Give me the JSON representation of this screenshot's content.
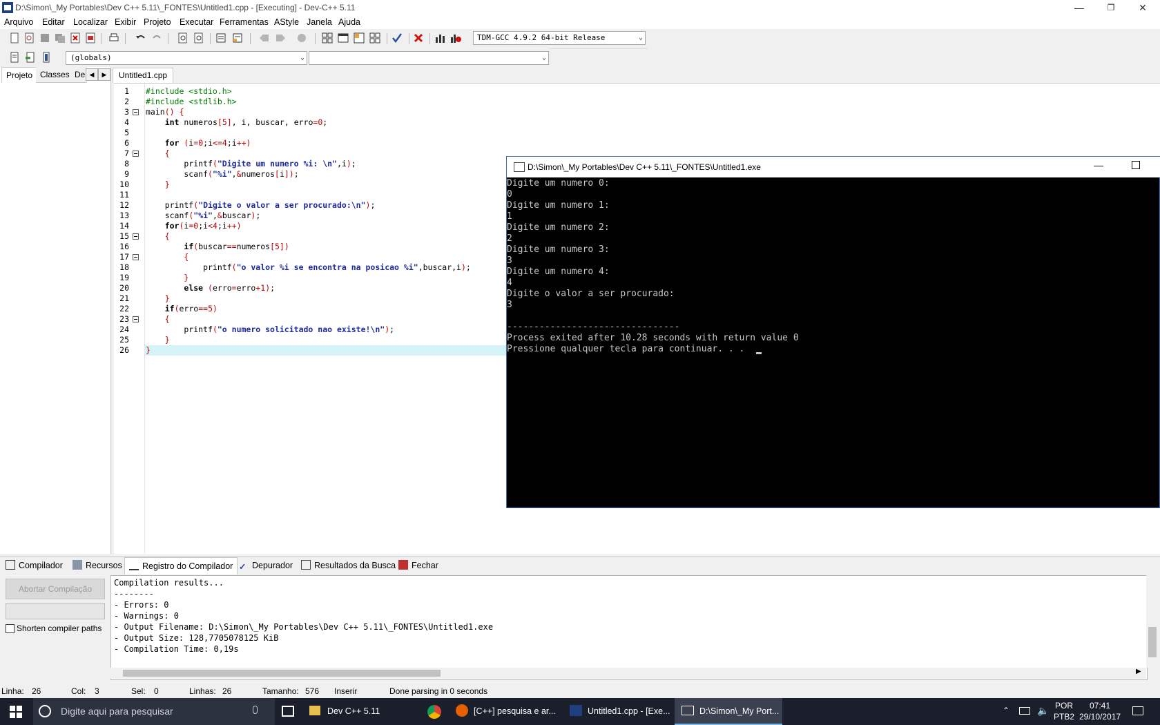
{
  "window": {
    "title": "D:\\Simon\\_My Portables\\Dev C++ 5.11\\_FONTES\\Untitled1.cpp - [Executing] - Dev-C++ 5.11"
  },
  "menu": [
    "Arquivo",
    "Editar",
    "Localizar",
    "Exibir",
    "Projeto",
    "Executar",
    "Ferramentas",
    "AStyle",
    "Janela",
    "Ajuda"
  ],
  "toolbar": {
    "compiler": "TDM-GCC 4.9.2 64-bit Release"
  },
  "toolbar2": {
    "scope": "(globals)",
    "member": ""
  },
  "leftpane": {
    "tabs": [
      "Projeto",
      "Classes",
      "De"
    ]
  },
  "editor": {
    "tab": "Untitled1.cpp",
    "line_numbers": [
      "1",
      "2",
      "3",
      "4",
      "5",
      "6",
      "7",
      "8",
      "9",
      "10",
      "11",
      "12",
      "13",
      "14",
      "15",
      "16",
      "17",
      "18",
      "19",
      "20",
      "21",
      "22",
      "23",
      "24",
      "25",
      "26"
    ]
  },
  "console": {
    "title": "D:\\Simon\\_My Portables\\Dev C++ 5.11\\_FONTES\\Untitled1.exe",
    "output": "Digite um numero 0:\n0\nDigite um numero 1:\n1\nDigite um numero 2:\n2\nDigite um numero 3:\n3\nDigite um numero 4:\n4\nDigite o valor a ser procurado:\n3\n\n--------------------------------\nProcess exited after 10.28 seconds with return value 0\nPressione qualquer tecla para continuar. . . "
  },
  "bottom": {
    "tabs": [
      "Compilador",
      "Recursos",
      "Registro do Compilador",
      "Depurador",
      "Resultados da Busca",
      "Fechar"
    ],
    "abort_label": "Abortar Compilação",
    "shorten_label": "Shorten compiler paths",
    "log": "Compilation results...\n--------\n- Errors: 0\n- Warnings: 0\n- Output Filename: D:\\Simon\\_My Portables\\Dev C++ 5.11\\_FONTES\\Untitled1.exe\n- Output Size: 128,7705078125 KiB\n- Compilation Time: 0,19s"
  },
  "status": {
    "linha_label": "Linha:",
    "linha": "26",
    "col_label": "Col:",
    "col": "3",
    "sel_label": "Sel:",
    "sel": "0",
    "linhas_label": "Linhas:",
    "linhas": "26",
    "tamanho_label": "Tamanho:",
    "tamanho": "576",
    "mode": "Inserir",
    "message": "Done parsing in 0 seconds"
  },
  "taskbar": {
    "search_placeholder": "Digite aqui para pesquisar",
    "items": [
      "Dev C++ 5.11",
      "[C++] pesquisa e ar...",
      "Untitled1.cpp - [Exe...",
      "D:\\Simon\\_My Port..."
    ],
    "lang": "POR",
    "layout": "PTB2",
    "time": "07:41",
    "date": "29/10/2017"
  }
}
